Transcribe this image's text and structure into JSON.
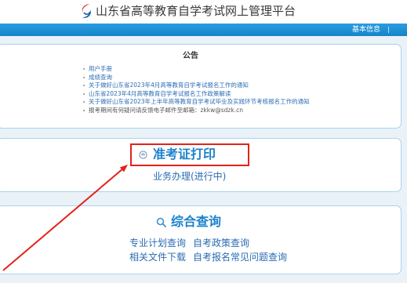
{
  "header": {
    "title": "山东省高等教育自学考试网上管理平台",
    "logo_icon": "logo-icon"
  },
  "nav": {
    "items": [
      "基本信息"
    ]
  },
  "notice": {
    "title": "公告",
    "items": [
      "用户手册",
      "成绩查询",
      "关于做好山东省2023年4月高等教育自学考试报名工作的通知",
      "山东省2023年4月高等教育自学考试报名工作政策解读",
      "关于做好山东省2023年上半年高等教育自学考试毕业及实践环节考核报名工作的通知",
      "报考期间有何疑问请反馈电子邮件至邮箱：zkkw@sdzk.cn"
    ]
  },
  "admit_card": {
    "icon": "circle-minus-icon",
    "title": "准考证打印",
    "status": "业务办理(进行中)"
  },
  "query": {
    "icon": "search-icon",
    "title": "综合查询",
    "links": [
      "专业计划查询",
      "自考政策查询",
      "相关文件下载",
      "自考报名常见问题查询"
    ]
  },
  "colors": {
    "page_bg": "#eaf2f8",
    "nav_bar": "#1584c8",
    "nav_bar_light": "#2b9de0",
    "panel_border": "#a8d3ee",
    "link": "#2b6cb3",
    "title_blue": "#1b82cc",
    "annotation_red": "#e32219"
  }
}
